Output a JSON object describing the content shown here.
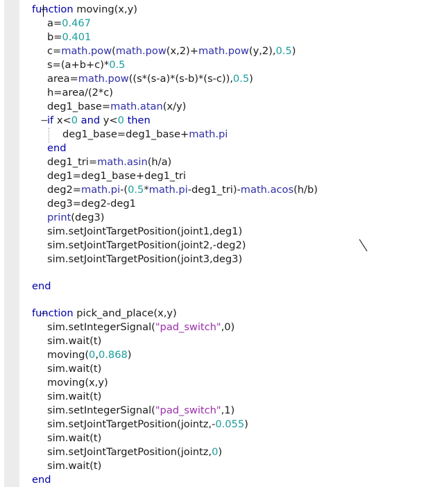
{
  "editor": {
    "fold_markers": [
      "−",
      "−",
      "−"
    ],
    "lines": [
      [
        {
          "t": "function",
          "c": "kw"
        },
        {
          "t": " moving(x,y)",
          "c": "txt"
        }
      ],
      [
        {
          "t": "a=",
          "c": "txt"
        },
        {
          "t": "0.467",
          "c": "num"
        }
      ],
      [
        {
          "t": "b=",
          "c": "txt"
        },
        {
          "t": "0.401",
          "c": "num"
        }
      ],
      [
        {
          "t": "c=",
          "c": "txt"
        },
        {
          "t": "math.pow",
          "c": "fn"
        },
        {
          "t": "(",
          "c": "txt"
        },
        {
          "t": "math.pow",
          "c": "fn"
        },
        {
          "t": "(x,2)+",
          "c": "txt"
        },
        {
          "t": "math.pow",
          "c": "fn"
        },
        {
          "t": "(y,2),",
          "c": "txt"
        },
        {
          "t": "0.5",
          "c": "num"
        },
        {
          "t": ")",
          "c": "txt"
        }
      ],
      [
        {
          "t": "s=(a+b+c)*",
          "c": "txt"
        },
        {
          "t": "0.5",
          "c": "num"
        }
      ],
      [
        {
          "t": "area=",
          "c": "txt"
        },
        {
          "t": "math.pow",
          "c": "fn"
        },
        {
          "t": "((s*(s-a)*(s-b)*(s-c)),",
          "c": "txt"
        },
        {
          "t": "0.5",
          "c": "num"
        },
        {
          "t": ")",
          "c": "txt"
        }
      ],
      [
        {
          "t": "h=area/(2*c)",
          "c": "txt"
        }
      ],
      [
        {
          "t": "deg1_base=",
          "c": "txt"
        },
        {
          "t": "math.atan",
          "c": "fn"
        },
        {
          "t": "(x/y)",
          "c": "txt"
        }
      ],
      [
        {
          "t": "if",
          "c": "kw"
        },
        {
          "t": " x<",
          "c": "txt"
        },
        {
          "t": "0",
          "c": "num"
        },
        {
          "t": " ",
          "c": "txt"
        },
        {
          "t": "and",
          "c": "kw"
        },
        {
          "t": " y<",
          "c": "txt"
        },
        {
          "t": "0",
          "c": "num"
        },
        {
          "t": " ",
          "c": "txt"
        },
        {
          "t": "then",
          "c": "kw"
        }
      ],
      [
        {
          "t": "deg1_base=deg1_base+",
          "c": "txt"
        },
        {
          "t": "math.pi",
          "c": "fn"
        }
      ],
      [
        {
          "t": "end",
          "c": "kw"
        }
      ],
      [
        {
          "t": "deg1_tri=",
          "c": "txt"
        },
        {
          "t": "math.asin",
          "c": "fn"
        },
        {
          "t": "(h/a)",
          "c": "txt"
        }
      ],
      [
        {
          "t": "deg1=deg1_base+deg1_tri",
          "c": "txt"
        }
      ],
      [
        {
          "t": "deg2=",
          "c": "txt"
        },
        {
          "t": "math.pi",
          "c": "fn"
        },
        {
          "t": "-(",
          "c": "txt"
        },
        {
          "t": "0.5",
          "c": "num"
        },
        {
          "t": "*",
          "c": "txt"
        },
        {
          "t": "math.pi",
          "c": "fn"
        },
        {
          "t": "-deg1_tri)-",
          "c": "txt"
        },
        {
          "t": "math.acos",
          "c": "fn"
        },
        {
          "t": "(h/b)",
          "c": "txt"
        }
      ],
      [
        {
          "t": "deg3=deg2-deg1",
          "c": "txt"
        }
      ],
      [
        {
          "t": "print",
          "c": "fn"
        },
        {
          "t": "(deg3)",
          "c": "txt"
        }
      ],
      [
        {
          "t": "sim.setJointTargetPosition(joint1,deg1)",
          "c": "txt"
        }
      ],
      [
        {
          "t": "sim.setJointTargetPosition(joint2,-deg2)",
          "c": "txt"
        }
      ],
      [
        {
          "t": "sim.setJointTargetPosition(joint3,deg3)",
          "c": "txt"
        }
      ],
      [],
      [
        {
          "t": "end",
          "c": "kw"
        }
      ],
      [],
      [
        {
          "t": "function",
          "c": "kw"
        },
        {
          "t": " pick_and_place(x,y)",
          "c": "txt"
        }
      ],
      [
        {
          "t": "sim.setIntegerSignal(",
          "c": "txt"
        },
        {
          "t": "\"pad_switch\"",
          "c": "str"
        },
        {
          "t": ",0)",
          "c": "txt"
        }
      ],
      [
        {
          "t": "sim.wait(t)",
          "c": "txt"
        }
      ],
      [
        {
          "t": "moving(",
          "c": "txt"
        },
        {
          "t": "0",
          "c": "num"
        },
        {
          "t": ",",
          "c": "txt"
        },
        {
          "t": "0.868",
          "c": "num"
        },
        {
          "t": ")",
          "c": "txt"
        }
      ],
      [
        {
          "t": "sim.wait(t)",
          "c": "txt"
        }
      ],
      [
        {
          "t": "moving(x,y)",
          "c": "txt"
        }
      ],
      [
        {
          "t": "sim.wait(t)",
          "c": "txt"
        }
      ],
      [
        {
          "t": "sim.setIntegerSignal(",
          "c": "txt"
        },
        {
          "t": "\"pad_switch\"",
          "c": "str"
        },
        {
          "t": ",1)",
          "c": "txt"
        }
      ],
      [
        {
          "t": "sim.setJointTargetPosition(jointz,-",
          "c": "txt"
        },
        {
          "t": "0.055",
          "c": "num"
        },
        {
          "t": ")",
          "c": "txt"
        }
      ],
      [
        {
          "t": "sim.wait(t)",
          "c": "txt"
        }
      ],
      [
        {
          "t": "sim.setJointTargetPosition(jointz,",
          "c": "txt"
        },
        {
          "t": "0",
          "c": "num"
        },
        {
          "t": ")",
          "c": "txt"
        }
      ],
      [
        {
          "t": "sim.wait(t)",
          "c": "txt"
        }
      ],
      [
        {
          "t": "end",
          "c": "kw"
        }
      ]
    ]
  }
}
